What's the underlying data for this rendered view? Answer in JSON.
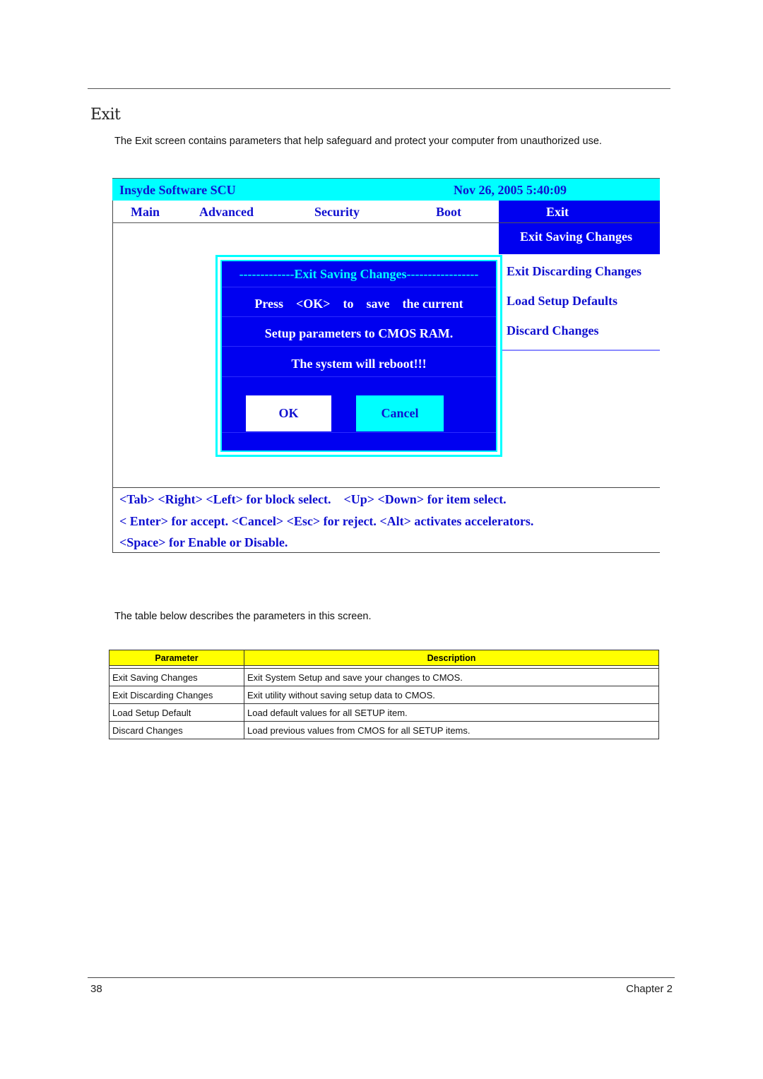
{
  "page": {
    "section_title": "Exit",
    "intro": "The Exit screen contains parameters that help safeguard and protect your computer from unauthorized use.",
    "table_caption": "The table below describes the parameters in this screen.",
    "footer": {
      "page_number": "38",
      "chapter": "Chapter 2"
    }
  },
  "bios": {
    "title": "Insyde Software SCU",
    "datetime": "Nov 26, 2005 5:40:09",
    "menu": [
      "Main",
      "Advanced",
      "Security",
      "Boot",
      "Exit"
    ],
    "active_menu": "Exit",
    "exit_items": [
      "Exit Saving Changes",
      "Exit Discarding Changes",
      "Load Setup Defaults",
      "Discard Changes"
    ],
    "selected_item": "Exit Saving Changes",
    "dialog": {
      "title": "-------------Exit Saving Changes-----------------",
      "line1": "Press    <OK>    to    save    the current",
      "line2": "Setup parameters to CMOS RAM.",
      "line3": "The system will reboot!!!",
      "ok_label": "OK",
      "cancel_label": "Cancel"
    },
    "help": [
      "<Tab> <Right> <Left> for block select.    <Up> <Down> for item select.",
      "< Enter> for accept. <Cancel> <Esc> for reject. <Alt> activates accelerators.",
      "<Space> for Enable or Disable."
    ],
    "colors": {
      "header_bg": "#00ffff",
      "selected_bg": "#0000f0",
      "text_blue": "#1010d0"
    }
  },
  "table": {
    "headers": [
      "Parameter",
      "Description"
    ],
    "rows": [
      [
        "Exit Saving Changes",
        "Exit System Setup and save your changes to CMOS."
      ],
      [
        "Exit Discarding Changes",
        "Exit utility without saving setup data to CMOS."
      ],
      [
        "Load Setup Default",
        "Load default values for all SETUP item."
      ],
      [
        "Discard Changes",
        "Load previous values from CMOS for all SETUP items."
      ]
    ],
    "header_color": "#ffff00"
  }
}
